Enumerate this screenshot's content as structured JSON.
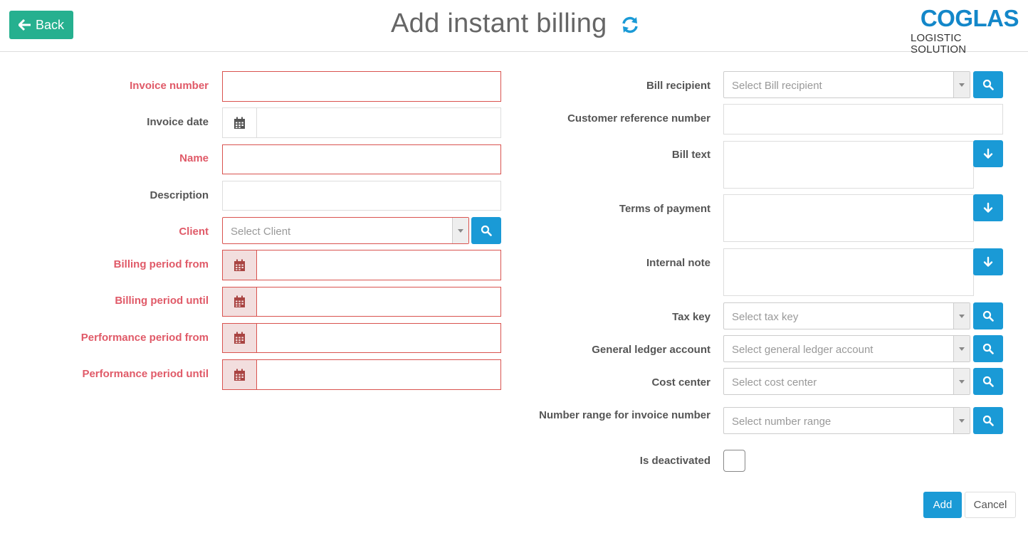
{
  "header": {
    "back_label": "Back",
    "title": "Add instant billing",
    "logo_main": "COGLAS",
    "logo_sub": "LOGISTIC SOLUTION"
  },
  "left_form": {
    "invoice_number_label": "Invoice number",
    "invoice_date_label": "Invoice date",
    "name_label": "Name",
    "description_label": "Description",
    "client_label": "Client",
    "client_placeholder": "Select Client",
    "billing_period_from_label": "Billing period from",
    "billing_period_until_label": "Billing period until",
    "performance_period_from_label": "Performance period from",
    "performance_period_until_label": "Performance period until"
  },
  "right_form": {
    "bill_recipient_label": "Bill recipient",
    "bill_recipient_placeholder": "Select Bill recipient",
    "customer_reference_label": "Customer reference number",
    "bill_text_label": "Bill text",
    "terms_of_payment_label": "Terms of payment",
    "internal_note_label": "Internal note",
    "tax_key_label": "Tax key",
    "tax_key_placeholder": "Select tax key",
    "gl_account_label": "General ledger account",
    "gl_account_placeholder": "Select general ledger account",
    "cost_center_label": "Cost center",
    "cost_center_placeholder": "Select cost center",
    "number_range_label": "Number range for invoice number",
    "number_range_placeholder": "Select number range",
    "is_deactivated_label": "Is deactivated"
  },
  "footer": {
    "add_label": "Add",
    "cancel_label": "Cancel"
  },
  "colors": {
    "back_button": "#26b08f",
    "primary": "#1a9ad6",
    "required_label": "#e05a68",
    "error_border": "#d9534f",
    "logo": "#1387c9"
  }
}
